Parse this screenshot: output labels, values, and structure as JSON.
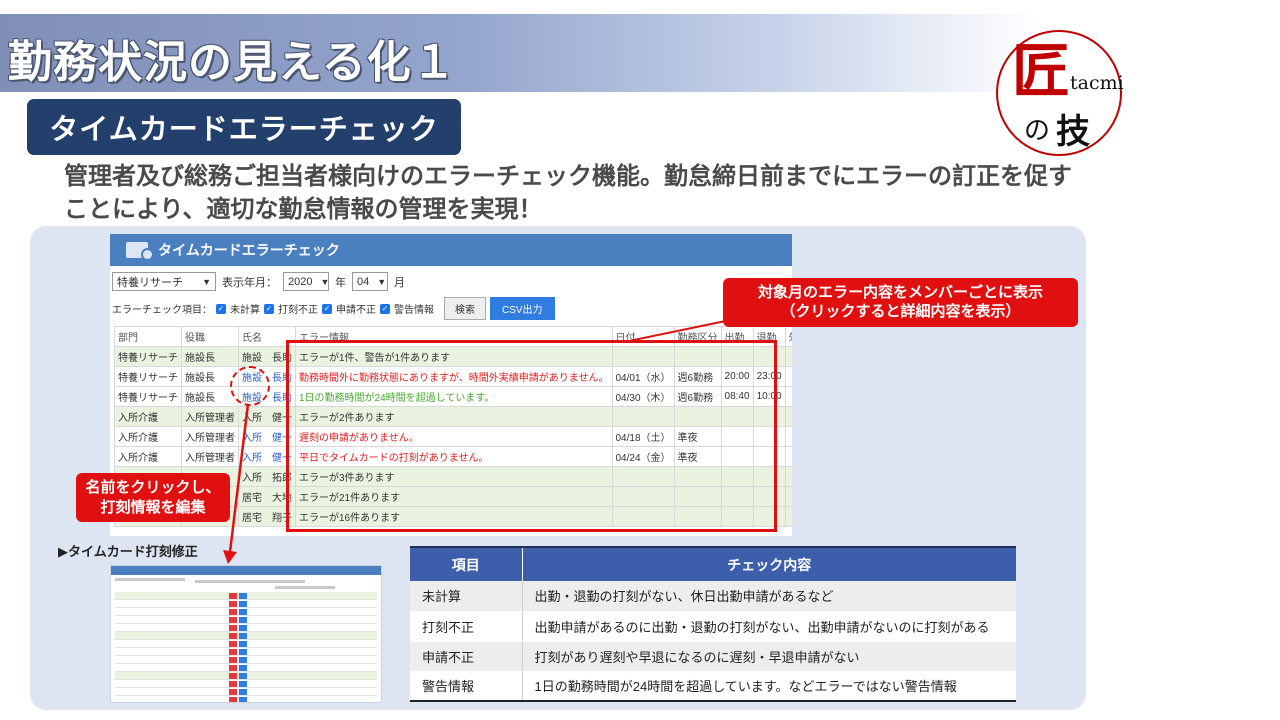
{
  "title": "勤務状況の見える化１",
  "logo": {
    "kanji": "匠",
    "roman": "tacmi",
    "no": "の",
    "waza": "技"
  },
  "subtitle": "タイムカードエラーチェック",
  "description": "管理者及び総務ご担当者様向けのエラーチェック機能。勤怠締日前までにエラーの訂正を促すことにより、適切な勤怠情報の管理を実現！",
  "app": {
    "header_title": "タイムカードエラーチェック",
    "department_select": "特養リサーチ",
    "display_month_label": "表示年月：",
    "year_select": "2020",
    "year_unit": "年",
    "month_select": "04",
    "month_unit": "月",
    "check_items_label": "エラーチェック項目：",
    "checks": [
      "未計算",
      "打刻不正",
      "申請不正",
      "警告情報"
    ],
    "search_button": "検索",
    "csv_button": "CSV出力",
    "columns": [
      "部門",
      "役職",
      "氏名",
      "エラー情報",
      "日付",
      "勤務区分",
      "出勤",
      "退勤",
      "外出"
    ],
    "rows": [
      {
        "dept": "特養リサーチ",
        "role": "施設長",
        "name": "施設　長助",
        "error": "エラーが1件、警告が1件あります",
        "date": "",
        "shift": "",
        "in": "",
        "out": "",
        "type": "summary"
      },
      {
        "dept": "特養リサーチ",
        "role": "施設長",
        "name": "施設　長助",
        "error": "勤務時間外に勤務状態にありますが、時間外実績申請がありません。",
        "date": "04/01（水）",
        "shift": "週6勤務",
        "in": "20:00",
        "out": "23:00",
        "type": "error"
      },
      {
        "dept": "特養リサーチ",
        "role": "施設長",
        "name": "施設　長助",
        "error": "1日の勤務時間が24時間を超過しています。",
        "date": "04/30（木）",
        "shift": "週6勤務",
        "in": "08:40",
        "out": "10:00",
        "type": "warning"
      },
      {
        "dept": "入所介護",
        "role": "入所管理者",
        "name": "入所　健一",
        "error": "エラーが2件あります",
        "date": "",
        "shift": "",
        "in": "",
        "out": "",
        "type": "summary"
      },
      {
        "dept": "入所介護",
        "role": "入所管理者",
        "name": "入所　健一",
        "error": "遅刻の申請がありません。",
        "date": "04/18（土）",
        "shift": "準夜",
        "in": "",
        "out": "",
        "type": "error"
      },
      {
        "dept": "入所介護",
        "role": "入所管理者",
        "name": "入所　健一",
        "error": "平日でタイムカードの打刻がありません。",
        "date": "04/24（金）",
        "shift": "準夜",
        "in": "",
        "out": "",
        "type": "error"
      },
      {
        "dept": "",
        "role": "",
        "name": "入所　拓郎",
        "error": "エラーが3件あります",
        "date": "",
        "shift": "",
        "in": "",
        "out": "",
        "type": "summary"
      },
      {
        "dept": "",
        "role": "",
        "name": "居宅　大地",
        "error": "エラーが21件あります",
        "date": "",
        "shift": "",
        "in": "",
        "out": "",
        "type": "summary"
      },
      {
        "dept": "",
        "role": "",
        "name": "居宅　翔子",
        "error": "エラーが16件あります",
        "date": "",
        "shift": "",
        "in": "",
        "out": "",
        "type": "summary"
      }
    ]
  },
  "callout_right": {
    "line1": "対象月のエラー内容をメンバーごとに表示",
    "line2": "（クリックすると詳細内容を表示）"
  },
  "callout_left": {
    "line1": "名前をクリックし、",
    "line2": "打刻情報を編集"
  },
  "sublabel": "▶タイムカード打刻修正",
  "check_table": {
    "headers": [
      "項目",
      "チェック内容"
    ],
    "rows": [
      {
        "item": "未計算",
        "content": "出勤・退勤の打刻がない、休日出勤申請があるなど"
      },
      {
        "item": "打刻不正",
        "content": "出勤申請があるのに出勤・退勤の打刻がない、出勤申請がないのに打刻がある"
      },
      {
        "item": "申請不正",
        "content": "打刻があり遅刻や早退になるのに遅刻・早退申請がない"
      },
      {
        "item": "警告情報",
        "content": "1日の勤務時間が24時間を超過しています。などエラーではない警告情報"
      }
    ]
  },
  "colors": {
    "title_band": "#8a9bc4",
    "subtitle_bg": "#22406b",
    "accent_red": "#e01010",
    "table_header": "#3d5eab",
    "app_header": "#4a7fc0"
  }
}
